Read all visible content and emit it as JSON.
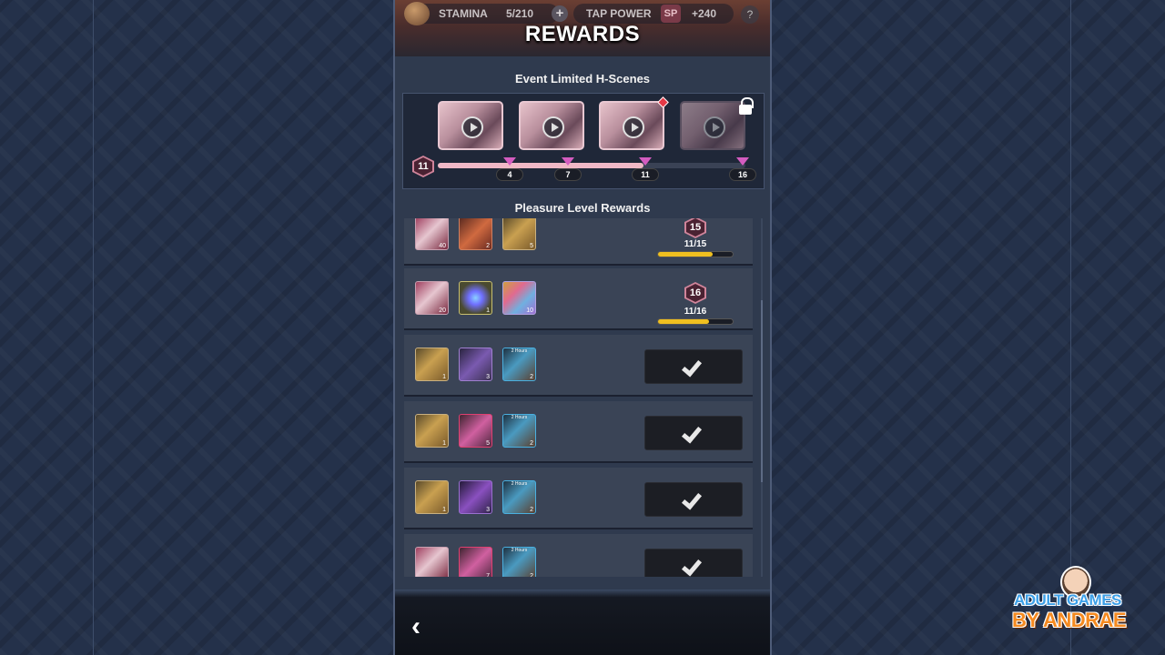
{
  "header": {
    "stamina_label": "STAMINA",
    "stamina_value": "5/210",
    "plus_icon": "+",
    "tap_power_label": "TAP POWER",
    "sp_icon": "SP",
    "tap_power_value": "+240",
    "help_icon": "?",
    "title": "REWARDS"
  },
  "event_scenes": {
    "title": "Event Limited H-Scenes",
    "current_level": "11",
    "progress": {
      "current": 11,
      "max": 16
    },
    "milestones": [
      "4",
      "7",
      "11",
      "16"
    ],
    "scenes": [
      {
        "state": "unlocked"
      },
      {
        "state": "unlocked"
      },
      {
        "state": "unlocked-new"
      },
      {
        "state": "locked"
      }
    ]
  },
  "pleasure": {
    "title": "Pleasure Level Rewards",
    "rows": [
      {
        "level": "15",
        "progress_text": "11/15",
        "progress": 0.733,
        "claimed": false,
        "items": [
          {
            "icon": "girl-card-icon",
            "count": "40"
          },
          {
            "icon": "red-chest-icon",
            "count": "2"
          },
          {
            "icon": "gold-ticket-icon",
            "count": "5"
          }
        ]
      },
      {
        "level": "16",
        "progress_text": "11/16",
        "progress": 0.6875,
        "claimed": false,
        "items": [
          {
            "icon": "girl-card-icon",
            "count": "20"
          },
          {
            "icon": "gem-icon",
            "count": "1"
          },
          {
            "icon": "rainbow-ticket-icon",
            "count": "10"
          }
        ]
      },
      {
        "claimed": true,
        "items": [
          {
            "icon": "gold-ticket-icon",
            "count": "1"
          },
          {
            "icon": "purple-chest-icon",
            "count": "3"
          },
          {
            "icon": "potion-icon",
            "count": "2",
            "tag": "2 Hours"
          }
        ]
      },
      {
        "claimed": true,
        "items": [
          {
            "icon": "gold-ticket-icon",
            "count": "1"
          },
          {
            "icon": "pink-chest-icon",
            "count": "5"
          },
          {
            "icon": "potion-icon",
            "count": "2",
            "tag": "2 Hours"
          }
        ]
      },
      {
        "claimed": true,
        "items": [
          {
            "icon": "gold-ticket-icon",
            "count": "1"
          },
          {
            "icon": "violet-chest-icon",
            "count": "3"
          },
          {
            "icon": "potion-icon",
            "count": "2",
            "tag": "2 Hours"
          }
        ]
      },
      {
        "claimed": true,
        "items": [
          {
            "icon": "girl-card-icon",
            "count": ""
          },
          {
            "icon": "pink-chest-icon",
            "count": "7"
          },
          {
            "icon": "potion-icon",
            "count": "2",
            "tag": "2 Hours"
          }
        ]
      }
    ]
  },
  "footer": {
    "back_icon": "‹"
  },
  "watermark": {
    "line1": "ADULT GAMES",
    "line2": "BY ANDRAE"
  }
}
